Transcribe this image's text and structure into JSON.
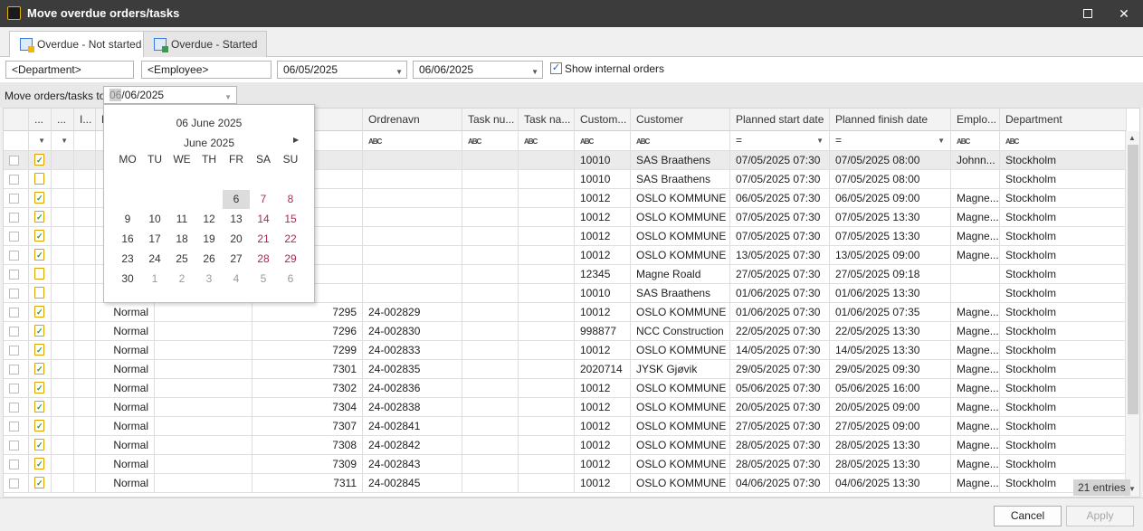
{
  "window": {
    "title": "Move overdue orders/tasks",
    "minimize": "—",
    "close": "✕"
  },
  "tabs": [
    {
      "label": "Overdue - Not started",
      "active": true
    },
    {
      "label": "Overdue - Started",
      "active": false
    }
  ],
  "filters": {
    "department": "<Department>",
    "employee": "<Employee>",
    "date_from": "06/05/2025",
    "date_to": "06/06/2025",
    "show_internal_checked": true,
    "show_internal_label": "Show internal orders"
  },
  "move": {
    "label": "Move orders/tasks to",
    "date_selected": "06",
    "date_rest": "/06/2025"
  },
  "grid": {
    "headers": [
      "",
      "...",
      "...",
      "I...",
      "P",
      "",
      "",
      "Ordrenavn",
      "Task nu...",
      "Task na...",
      "Custom...",
      "Customer",
      "Planned start date",
      "Planned finish date",
      "Emplo...",
      "Department"
    ],
    "filter_icon_text": "ABC",
    "filter_eq": "=",
    "rows": [
      {
        "icon": "clipboard-check",
        "priority": "",
        "num": "",
        "order": "",
        "cust_no": "10010",
        "customer": "SAS Braathens",
        "start": "07/05/2025 07:30",
        "finish": "07/05/2025 08:00",
        "emp": "Johnn...",
        "dept": "Stockholm"
      },
      {
        "icon": "clipboard",
        "priority": "",
        "num": "",
        "order": "",
        "cust_no": "10010",
        "customer": "SAS Braathens",
        "start": "07/05/2025 07:30",
        "finish": "07/05/2025 08:00",
        "emp": "",
        "dept": "Stockholm"
      },
      {
        "icon": "clipboard-check",
        "priority": "",
        "num": "",
        "order": "",
        "cust_no": "10012",
        "customer": "OSLO KOMMUNE",
        "start": "06/05/2025 07:30",
        "finish": "06/05/2025 09:00",
        "emp": "Magne...",
        "dept": "Stockholm"
      },
      {
        "icon": "clipboard-check",
        "priority": "",
        "num": "",
        "order": "",
        "cust_no": "10012",
        "customer": "OSLO KOMMUNE",
        "start": "07/05/2025 07:30",
        "finish": "07/05/2025 13:30",
        "emp": "Magne...",
        "dept": "Stockholm"
      },
      {
        "icon": "clipboard-check",
        "priority": "",
        "num": "",
        "order": "",
        "cust_no": "10012",
        "customer": "OSLO KOMMUNE",
        "start": "07/05/2025 07:30",
        "finish": "07/05/2025 13:30",
        "emp": "Magne...",
        "dept": "Stockholm"
      },
      {
        "icon": "clipboard-check",
        "priority": "",
        "num": "",
        "order": "",
        "cust_no": "10012",
        "customer": "OSLO KOMMUNE",
        "start": "13/05/2025 07:30",
        "finish": "13/05/2025 09:00",
        "emp": "Magne...",
        "dept": "Stockholm"
      },
      {
        "icon": "clipboard",
        "priority": "",
        "num": "",
        "order": "",
        "cust_no": "12345",
        "customer": "Magne Roald",
        "start": "27/05/2025 07:30",
        "finish": "27/05/2025 09:18",
        "emp": "",
        "dept": "Stockholm"
      },
      {
        "icon": "clipboard",
        "priority": "",
        "num": "",
        "order": "",
        "cust_no": "10010",
        "customer": "SAS Braathens",
        "start": "01/06/2025 07:30",
        "finish": "01/06/2025 13:30",
        "emp": "",
        "dept": "Stockholm"
      },
      {
        "icon": "clipboard-check",
        "priority": "Normal",
        "num": "7295",
        "order": "24-002829",
        "cust_no": "10012",
        "customer": "OSLO KOMMUNE",
        "start": "01/06/2025 07:30",
        "finish": "01/06/2025 07:35",
        "emp": "Magne...",
        "dept": "Stockholm"
      },
      {
        "icon": "clipboard-check",
        "priority": "Normal",
        "num": "7296",
        "order": "24-002830",
        "cust_no": "998877",
        "customer": "NCC Construction",
        "start": "22/05/2025 07:30",
        "finish": "22/05/2025 13:30",
        "emp": "Magne...",
        "dept": "Stockholm"
      },
      {
        "icon": "clipboard-check",
        "priority": "Normal",
        "num": "7299",
        "order": "24-002833",
        "cust_no": "10012",
        "customer": "OSLO KOMMUNE",
        "start": "14/05/2025 07:30",
        "finish": "14/05/2025 13:30",
        "emp": "Magne...",
        "dept": "Stockholm"
      },
      {
        "icon": "clipboard-check",
        "priority": "Normal",
        "num": "7301",
        "order": "24-002835",
        "cust_no": "2020714",
        "customer": "JYSK Gjøvik",
        "start": "29/05/2025 07:30",
        "finish": "29/05/2025 09:30",
        "emp": "Magne...",
        "dept": "Stockholm"
      },
      {
        "icon": "clipboard-check",
        "priority": "Normal",
        "num": "7302",
        "order": "24-002836",
        "cust_no": "10012",
        "customer": "OSLO KOMMUNE",
        "start": "05/06/2025 07:30",
        "finish": "05/06/2025 16:00",
        "emp": "Magne...",
        "dept": "Stockholm"
      },
      {
        "icon": "clipboard-check",
        "priority": "Normal",
        "num": "7304",
        "order": "24-002838",
        "cust_no": "10012",
        "customer": "OSLO KOMMUNE",
        "start": "20/05/2025 07:30",
        "finish": "20/05/2025 09:00",
        "emp": "Magne...",
        "dept": "Stockholm"
      },
      {
        "icon": "clipboard-check",
        "priority": "Normal",
        "num": "7307",
        "order": "24-002841",
        "cust_no": "10012",
        "customer": "OSLO KOMMUNE",
        "start": "27/05/2025 07:30",
        "finish": "27/05/2025 09:00",
        "emp": "Magne...",
        "dept": "Stockholm"
      },
      {
        "icon": "clipboard-check",
        "priority": "Normal",
        "num": "7308",
        "order": "24-002842",
        "cust_no": "10012",
        "customer": "OSLO KOMMUNE",
        "start": "28/05/2025 07:30",
        "finish": "28/05/2025 13:30",
        "emp": "Magne...",
        "dept": "Stockholm"
      },
      {
        "icon": "clipboard-check",
        "priority": "Normal",
        "num": "7309",
        "order": "24-002843",
        "cust_no": "10012",
        "customer": "OSLO KOMMUNE",
        "start": "28/05/2025 07:30",
        "finish": "28/05/2025 13:30",
        "emp": "Magne...",
        "dept": "Stockholm"
      },
      {
        "icon": "clipboard-check",
        "priority": "Normal",
        "num": "7311",
        "order": "24-002845",
        "cust_no": "10012",
        "customer": "OSLO KOMMUNE",
        "start": "04/06/2025 07:30",
        "finish": "04/06/2025 13:30",
        "emp": "Magne...",
        "dept": "Stockholm"
      }
    ],
    "entries": "21 entries"
  },
  "calendar": {
    "selected_date": "06 June 2025",
    "month_label": "June 2025",
    "next_icon": "arrow-right-icon",
    "dow": [
      "MO",
      "TU",
      "WE",
      "TH",
      "FR",
      "SA",
      "SU"
    ],
    "weeks": [
      [
        {
          "d": "6",
          "t": "selected"
        },
        {
          "d": "7",
          "t": "we"
        },
        {
          "d": "8",
          "t": "we"
        }
      ],
      [
        {
          "d": "9"
        },
        {
          "d": "10"
        },
        {
          "d": "11"
        },
        {
          "d": "12"
        },
        {
          "d": "13"
        },
        {
          "d": "14",
          "t": "we"
        },
        {
          "d": "15",
          "t": "we"
        }
      ],
      [
        {
          "d": "16"
        },
        {
          "d": "17"
        },
        {
          "d": "18"
        },
        {
          "d": "19"
        },
        {
          "d": "20"
        },
        {
          "d": "21",
          "t": "we"
        },
        {
          "d": "22",
          "t": "we"
        }
      ],
      [
        {
          "d": "23"
        },
        {
          "d": "24"
        },
        {
          "d": "25"
        },
        {
          "d": "26"
        },
        {
          "d": "27"
        },
        {
          "d": "28",
          "t": "we"
        },
        {
          "d": "29",
          "t": "we"
        }
      ],
      [
        {
          "d": "30"
        },
        {
          "d": "1",
          "t": "other"
        },
        {
          "d": "2",
          "t": "other"
        },
        {
          "d": "3",
          "t": "other"
        },
        {
          "d": "4",
          "t": "other"
        },
        {
          "d": "5",
          "t": "other"
        },
        {
          "d": "6",
          "t": "other"
        }
      ]
    ]
  },
  "footer": {
    "cancel": "Cancel",
    "apply": "Apply"
  }
}
